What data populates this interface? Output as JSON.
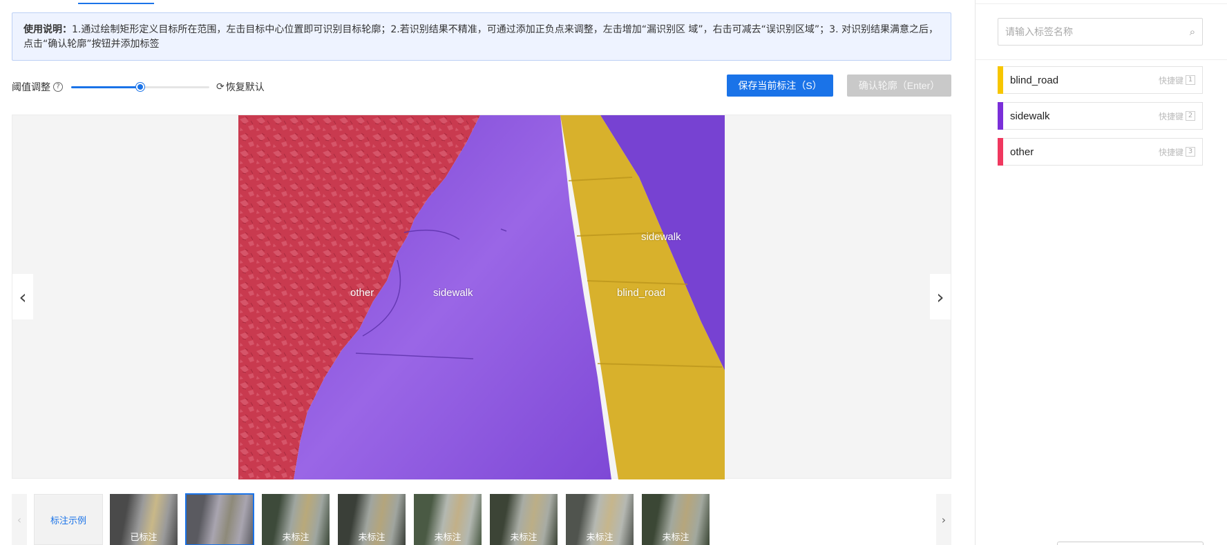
{
  "instructions": {
    "title": "使用说明：",
    "text": "1.通过绘制矩形定义目标所在范围，左击目标中心位置即可识别目标轮廓；2.若识别结果不精准，可通过添加正负点来调整，左击增加“漏识别区 域”，右击可减去“误识别区域”；3. 对识别结果满意之后，点击“确认轮廓”按钮并添加标签"
  },
  "threshold": {
    "label": "阈值调整",
    "help_icon": "?",
    "value": 0.5,
    "reset_label": "恢复默认",
    "reset_icon": "⟳"
  },
  "toolbar": {
    "save_label": "保存当前标注（S）",
    "confirm_label": "确认轮廓（Enter）"
  },
  "canvas": {
    "prev_icon": "‹",
    "next_icon": "›",
    "regions": [
      {
        "label": "other",
        "color": "#d8455a"
      },
      {
        "label": "sidewalk",
        "color": "#8a4ddd"
      },
      {
        "label": "blind_road",
        "color": "#e3bb2a"
      },
      {
        "label": "sidewalk",
        "color": "#7a45d6"
      }
    ]
  },
  "thumbnails": {
    "prev_icon": "‹",
    "next_icon": "›",
    "example_label": "标注示例",
    "items": [
      {
        "status": "已标注",
        "selected": false
      },
      {
        "status": "",
        "selected": true
      },
      {
        "status": "未标注",
        "selected": false
      },
      {
        "status": "未标注",
        "selected": false
      },
      {
        "status": "未标注",
        "selected": false
      },
      {
        "status": "未标注",
        "selected": false
      },
      {
        "status": "未标注",
        "selected": false
      },
      {
        "status": "未标注",
        "selected": false
      }
    ]
  },
  "labels_panel": {
    "search_placeholder": "请输入标签名称",
    "search_icon": "⌕",
    "shortcut_text": "快捷键",
    "items": [
      {
        "name": "blind_road",
        "color": "#f7c600",
        "key": "1"
      },
      {
        "name": "sidewalk",
        "color": "#7a2fd9",
        "key": "2"
      },
      {
        "name": "other",
        "color": "#f0385f",
        "key": "3"
      }
    ]
  }
}
